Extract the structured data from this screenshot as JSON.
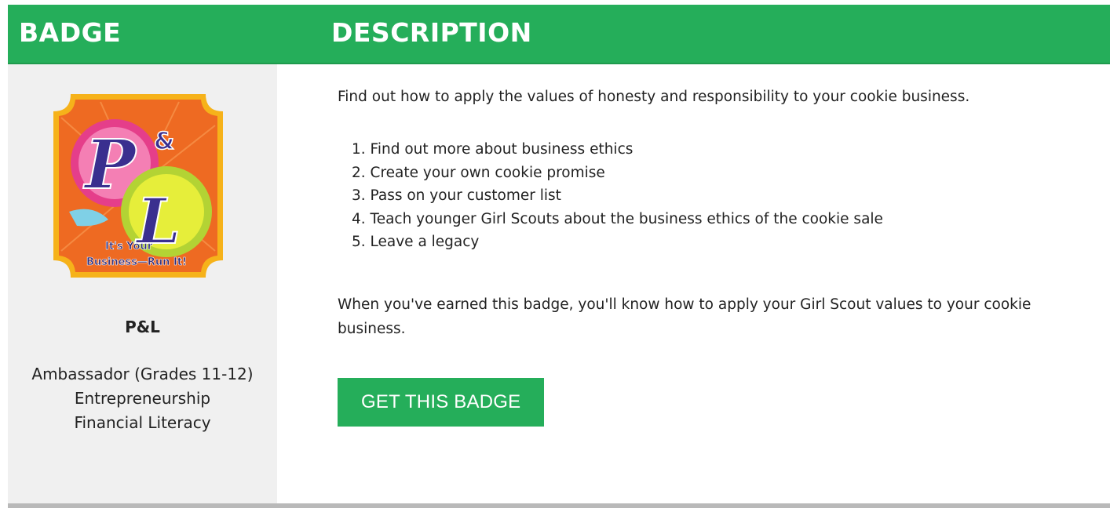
{
  "table": {
    "col_badge": "BADGE",
    "col_description": "DESCRIPTION"
  },
  "badge": {
    "image_text": "P&L",
    "image_tagline_1": "It's Your",
    "image_tagline_2": "Business—Run It!",
    "name": "P&L",
    "level": "Ambassador (Grades 11-12)",
    "category_1": "Entrepreneurship",
    "category_2": "Financial Literacy"
  },
  "description": {
    "intro": "Find out how to apply the values of honesty and responsibility to your cookie business.",
    "steps": [
      "1. Find out more about business ethics",
      "2. Create your own cookie promise",
      "3. Pass on your customer list",
      "4. Teach younger Girl Scouts about the business ethics of the cookie sale",
      "5. Leave a legacy"
    ],
    "outro": "When you've earned this badge, you'll know how to apply your Girl Scout values to your cookie business.",
    "cta_label": "GET THIS BADGE"
  },
  "colors": {
    "brand_green": "#25ae5a",
    "left_panel_bg": "#f0f0f0",
    "rule_gray": "#b9b9b9"
  }
}
